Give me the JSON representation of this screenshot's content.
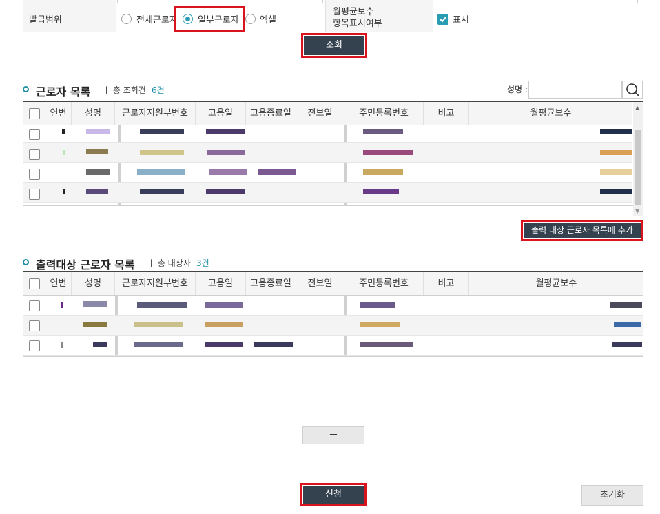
{
  "filter": {
    "issue_range_label": "발급범위",
    "radio_all": "전체근로자",
    "radio_partial": "일부근로자",
    "radio_excel": "엑셀",
    "salary_display_label_line1": "월평균보수",
    "salary_display_label_line2": "항목표시여부",
    "display_checkbox_label": "표시",
    "search_button": "조회"
  },
  "worker_list": {
    "title": "근로자 목록",
    "count_label": "총 조회건",
    "count_value": "6건",
    "name_search_label": "성명 :",
    "columns": [
      "연번",
      "성명",
      "근로자지원부번호",
      "고용일",
      "고용종료일",
      "전보일",
      "주민등록번호",
      "비고",
      "월평균보수"
    ],
    "add_button": "출력 대상 근로자 목록에 추가"
  },
  "target_list": {
    "title": "출력대상 근로자 목록",
    "count_label": "총 대상자",
    "count_value": "3건",
    "columns": [
      "연번",
      "성명",
      "근로자지원부번호",
      "고용일",
      "고용종료일",
      "전보일",
      "주민등록번호",
      "비고",
      "월평균보수"
    ],
    "remove_button": "－"
  },
  "footer": {
    "apply_button": "신청",
    "reset_button": "초기화"
  },
  "colors": {
    "accent": "#2a9db2",
    "button_dark": "#34414f",
    "highlight_red": "#d9141d"
  }
}
